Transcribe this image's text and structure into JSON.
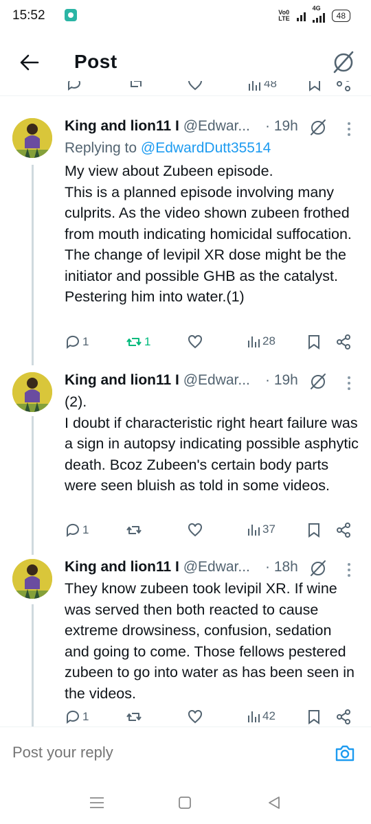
{
  "status_bar": {
    "time": "15:52",
    "network_top": "Vo0",
    "network_bottom": "LTE",
    "network_type": "4G",
    "battery": "48"
  },
  "header": {
    "title": "Post"
  },
  "previous_post": {
    "views": "48"
  },
  "tweets": [
    {
      "author_name": "King and lion11 I",
      "author_handle": "@Edwar...",
      "time": "· 19h",
      "replying_prefix": "Replying to ",
      "replying_handle": "@EdwardDutt35514",
      "text": "My view about Zubeen episode.\nThis is a planned episode involving many culprits. As the video shown zubeen frothed from mouth indicating homicidal suffocation. The change of levipil XR dose might be the initiator and possible GHB as the catalyst. Pestering him into water.(1)",
      "replies": "1",
      "reposts": "1",
      "likes": "",
      "views": "28"
    },
    {
      "author_name": "King and lion11 I",
      "author_handle": "@Edwar...",
      "time": "· 19h",
      "text": "(2).\nI doubt if characteristic right heart failure was a sign in autopsy indicating possible asphytic death. Bcoz Zubeen's certain body parts were seen bluish as told in some videos.",
      "replies": "1",
      "reposts": "",
      "likes": "",
      "views": "37"
    },
    {
      "author_name": "King and lion11 I",
      "author_handle": "@Edwar...",
      "time": "· 18h",
      "text": "They know zubeen took levipil XR. If wine was served then both reacted to cause extreme drowsiness, confusion, sedation and going to come. Those fellows pestered zubeen to go into water as has been seen in the videos.",
      "replies": "1",
      "reposts": "",
      "likes": "",
      "views": "42"
    }
  ],
  "reply_bar": {
    "placeholder": "Post your reply"
  },
  "colors": {
    "accent": "#1d9bf0",
    "repost_active": "#00ba7c",
    "secondary_text": "#536471"
  }
}
